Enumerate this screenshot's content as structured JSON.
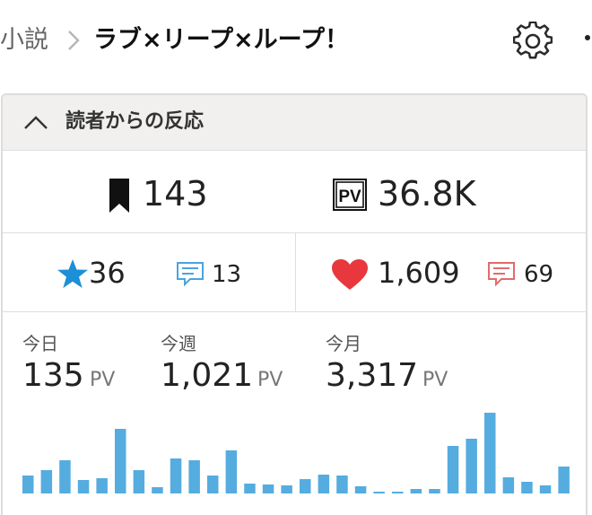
{
  "breadcrumb": {
    "parent": "小説",
    "current": "ラブ×リープ×ループ！"
  },
  "icons": {
    "separator": "chevron-right-icon",
    "settings": "gear-icon",
    "more": "more-dots-icon"
  },
  "panel": {
    "title": "読者からの反応",
    "collapse_icon": "chevron-up-icon"
  },
  "totals": {
    "bookmarks": "143",
    "pv": "36.8K"
  },
  "reactions": {
    "stars": "36",
    "reviews": "13",
    "hearts": "1,609",
    "comments": "69"
  },
  "stats": [
    {
      "label": "今日",
      "value": "135",
      "unit": "PV"
    },
    {
      "label": "今週",
      "value": "1,021",
      "unit": "PV"
    },
    {
      "label": "今月",
      "value": "3,317",
      "unit": "PV"
    }
  ],
  "colors": {
    "accent_blue": "#1d8fd6",
    "bar_blue": "#55acdf",
    "heart_red": "#e8383d",
    "comment_red": "#e36b6b",
    "review_blue": "#4aa3df",
    "panel_header_bg": "#f2f0ef"
  },
  "chart_data": {
    "type": "bar",
    "ylim": [
      0,
      92
    ],
    "values": [
      20,
      26,
      37,
      15,
      17,
      72,
      26,
      7,
      39,
      37,
      20,
      48,
      11,
      10,
      9,
      16,
      21,
      20,
      8,
      2,
      2,
      5,
      5,
      53,
      61,
      90,
      18,
      13,
      9,
      30
    ]
  }
}
